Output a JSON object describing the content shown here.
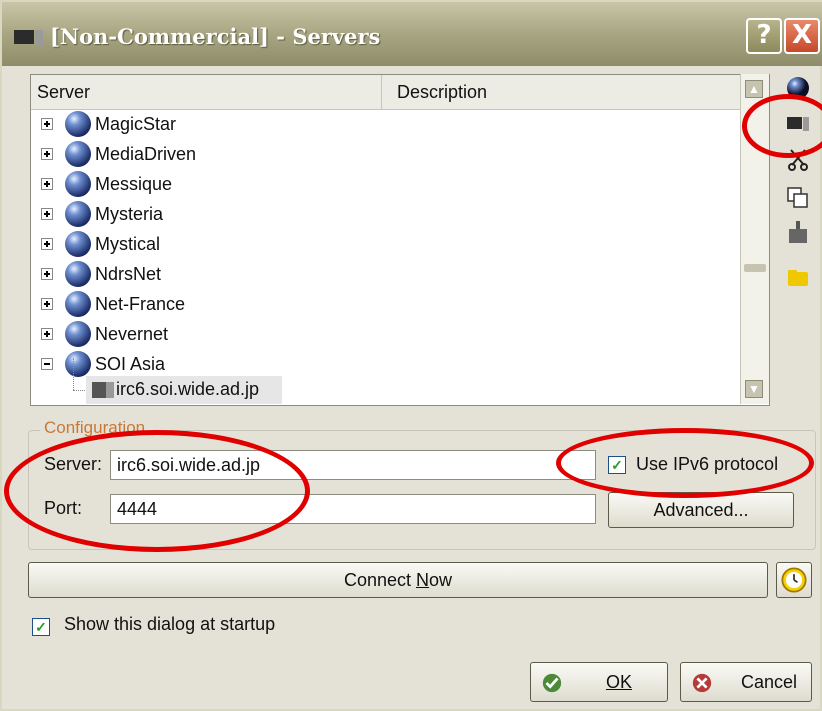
{
  "window": {
    "title": "[Non-Commercial] - Servers",
    "help_label": "?",
    "close_label": "X"
  },
  "list": {
    "columns": [
      "Server",
      "Description"
    ],
    "rows": [
      {
        "label": "MagicStar",
        "expanded": false
      },
      {
        "label": "MediaDriven",
        "expanded": false
      },
      {
        "label": "Messique",
        "expanded": false
      },
      {
        "label": "Mysteria",
        "expanded": false
      },
      {
        "label": "Mystical",
        "expanded": false
      },
      {
        "label": "NdrsNet",
        "expanded": false
      },
      {
        "label": "Net-France",
        "expanded": false
      },
      {
        "label": "Nevernet",
        "expanded": false
      },
      {
        "label": "SOI Asia",
        "expanded": true
      }
    ],
    "child": "irc6.soi.wide.ad.jp"
  },
  "toolbar": {
    "icons": [
      "globe-icon",
      "server-icon",
      "cut-icon",
      "copy-icon",
      "paste-icon",
      "folder-icon"
    ]
  },
  "config": {
    "group_label": "Configuration",
    "server_label": "Server:",
    "server_value": "irc6.soi.wide.ad.jp",
    "port_label": "Port:",
    "port_value": "4444",
    "ipv6_label": "Use IPv6 protocol",
    "ipv6_checked": true,
    "advanced_label": "Advanced..."
  },
  "connect": {
    "label_prefix": "Connect ",
    "label_mnemonic": "N",
    "label_suffix": "ow"
  },
  "startup": {
    "label": "Show this dialog at startup",
    "checked": true
  },
  "footer": {
    "ok_label": "OK",
    "cancel_label": "Cancel"
  },
  "annotations": {
    "color": "#e00000"
  }
}
